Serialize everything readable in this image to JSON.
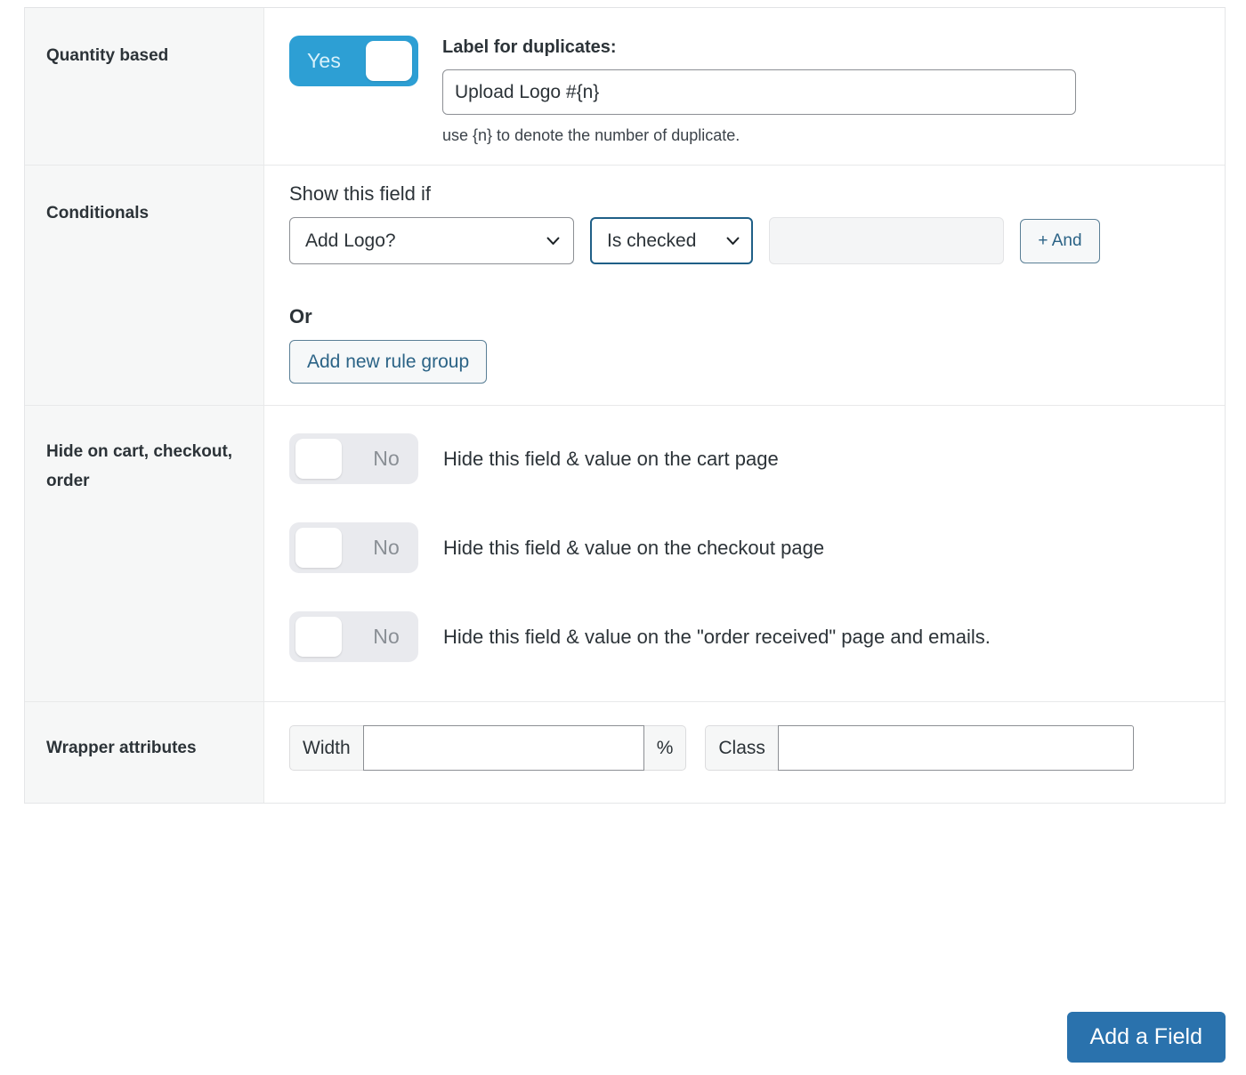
{
  "rows": {
    "quantity": {
      "label": "Quantity based",
      "toggle": {
        "state": "Yes",
        "on": true
      },
      "duplicates_label": "Label for duplicates:",
      "duplicates_value": "Upload Logo #{n}",
      "duplicates_help": "use {n} to denote the number of duplicate."
    },
    "conditionals": {
      "label": "Conditionals",
      "title": "Show this field if",
      "field_select": "Add Logo?",
      "operator_select": "Is checked",
      "value_input": "",
      "and_button": "+ And",
      "or_text": "Or",
      "add_rule_group_button": "Add new rule group"
    },
    "hide": {
      "label": "Hide on cart, checkout, order",
      "items": [
        {
          "toggle": "No",
          "on": false,
          "description": "Hide this field & value on the cart page"
        },
        {
          "toggle": "No",
          "on": false,
          "description": "Hide this field & value on the checkout page"
        },
        {
          "toggle": "No",
          "on": false,
          "description": "Hide this field & value on the \"order received\" page and emails."
        }
      ]
    },
    "wrapper": {
      "label": "Wrapper attributes",
      "width_label": "Width",
      "width_value": "",
      "percent_label": "%",
      "class_label": "Class",
      "class_value": ""
    }
  },
  "footer": {
    "add_field_button": "Add a Field"
  },
  "colors": {
    "toggle_on": "#2d9fd4",
    "toggle_off": "#e9eaee",
    "primary_button": "#2a72ad",
    "link": "#2b6386",
    "focus_border": "#1f5f87",
    "row_label_bg": "#f6f7f7"
  }
}
